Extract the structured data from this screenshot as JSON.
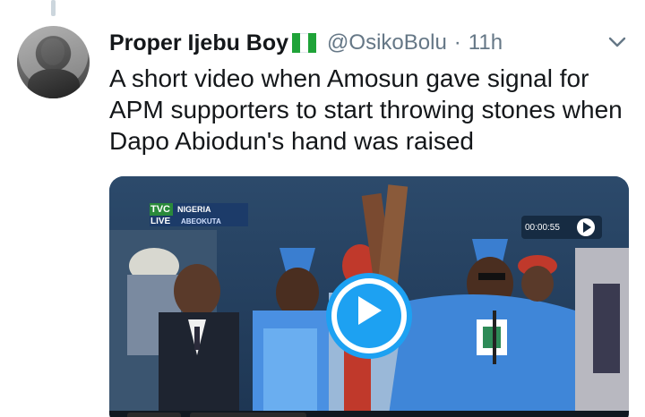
{
  "tweet": {
    "display_name": "Proper Ijebu Boy",
    "handle": "@OsikoBolu",
    "separator": "·",
    "time": "11h",
    "text": "A short video when Amosun gave signal for APM supporters to start throwing stones when Dapo Abiodun's hand was raised"
  },
  "video": {
    "channel_logo": "TVC",
    "channel_region": "NIGERIA",
    "live_label": "LIVE",
    "location": "ABEOKUTA",
    "timestamp": "00:00:55",
    "play_icon": "play-icon"
  },
  "icons": {
    "caret": "chevron-down-icon",
    "flag": "nigeria-flag-icon"
  },
  "colors": {
    "accent": "#1da1f2",
    "secondary_text": "#657786",
    "primary_text": "#14171a",
    "flag_green": "#1fa338"
  }
}
